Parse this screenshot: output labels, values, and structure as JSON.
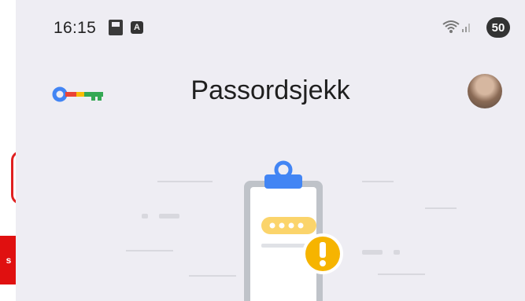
{
  "status_bar": {
    "time": "16:15",
    "notification_icons": [
      "sim-icon",
      "a-badge-icon"
    ],
    "battery_level": "50"
  },
  "app_bar": {
    "logo": "key-logo",
    "title": "Passordsjekk",
    "avatar": "user-avatar"
  },
  "illustration": {
    "name": "password-checkup-illustration"
  },
  "colors": {
    "background": "#eeedf3",
    "blue": "#4285f4",
    "yellow": "#f6b400",
    "green": "#34a853",
    "red": "#ea4335",
    "text": "#1f1f1f"
  }
}
